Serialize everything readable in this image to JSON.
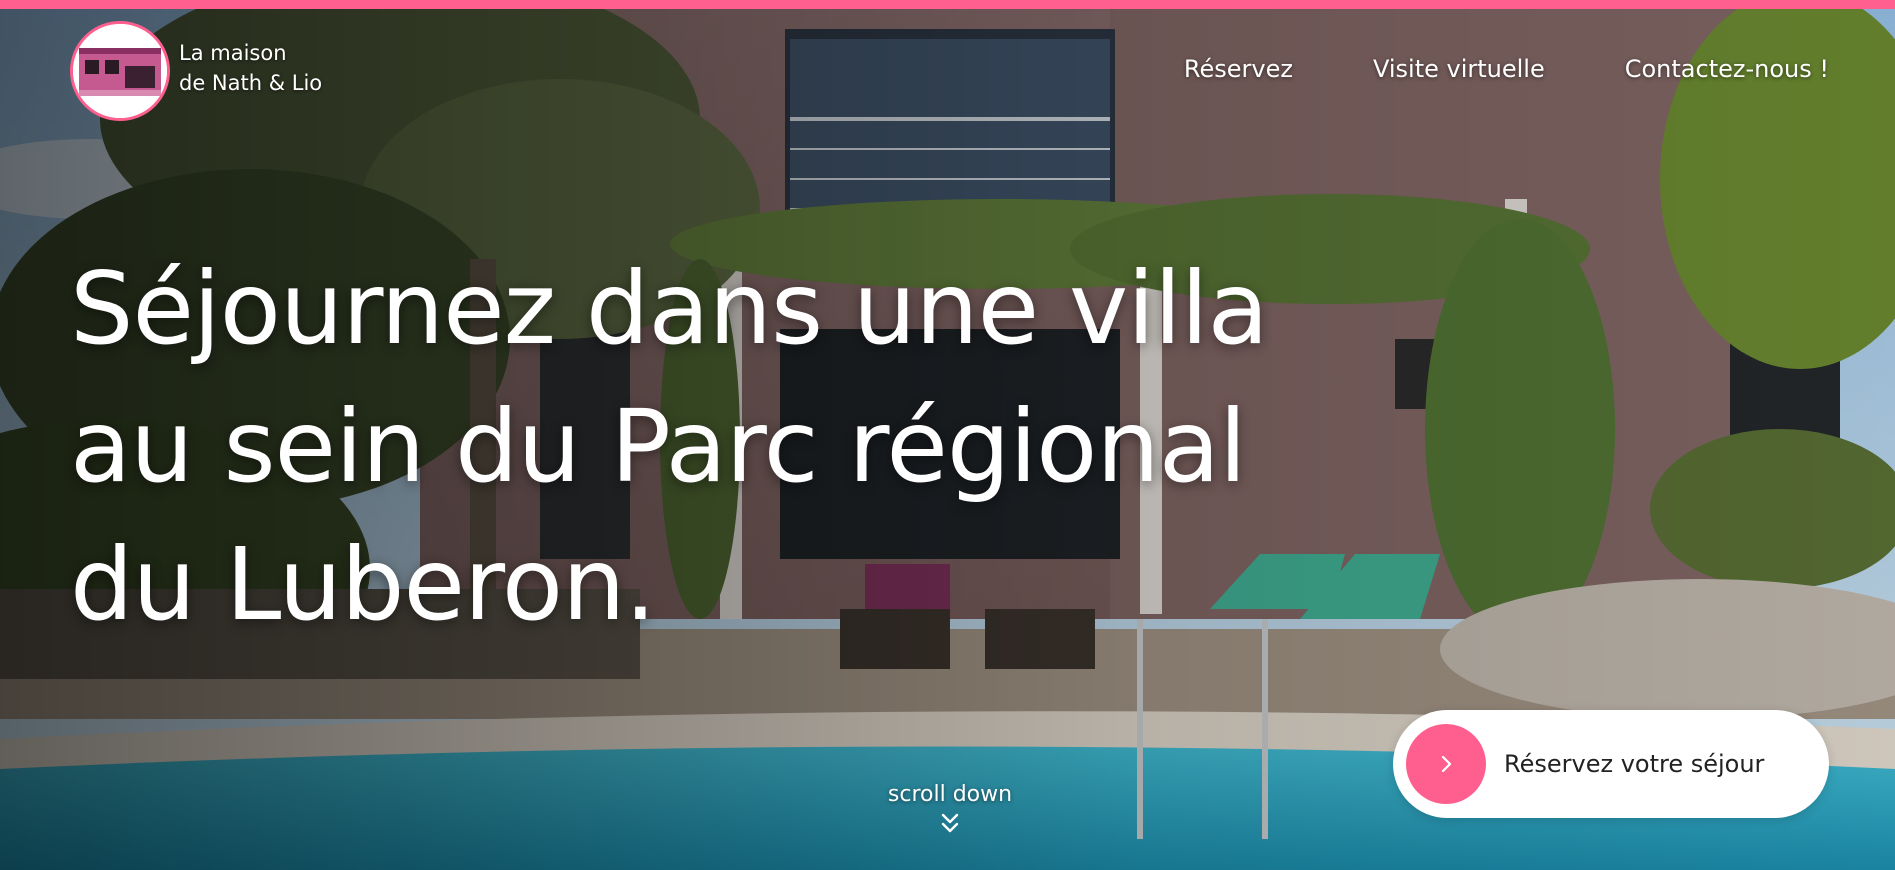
{
  "brand": {
    "line1": "La maison",
    "line2": "de Nath & Lio"
  },
  "nav": {
    "items": [
      "Réservez",
      "Visite virtuelle",
      "Contactez-nous !"
    ]
  },
  "hero": {
    "headline_lines": [
      "Séjournez dans une villa",
      "au sein du Parc régional",
      "du Luberon."
    ],
    "cta_label": "Réservez votre séjour",
    "scroll_label": "scroll down"
  },
  "colors": {
    "accent": "#ff5f8f",
    "text_light": "#ffffff",
    "cta_text": "#222222"
  },
  "icons": {
    "cta": "chevron-right-icon",
    "scroll": "double-chevron-down-icon",
    "logo": "house-logo"
  }
}
